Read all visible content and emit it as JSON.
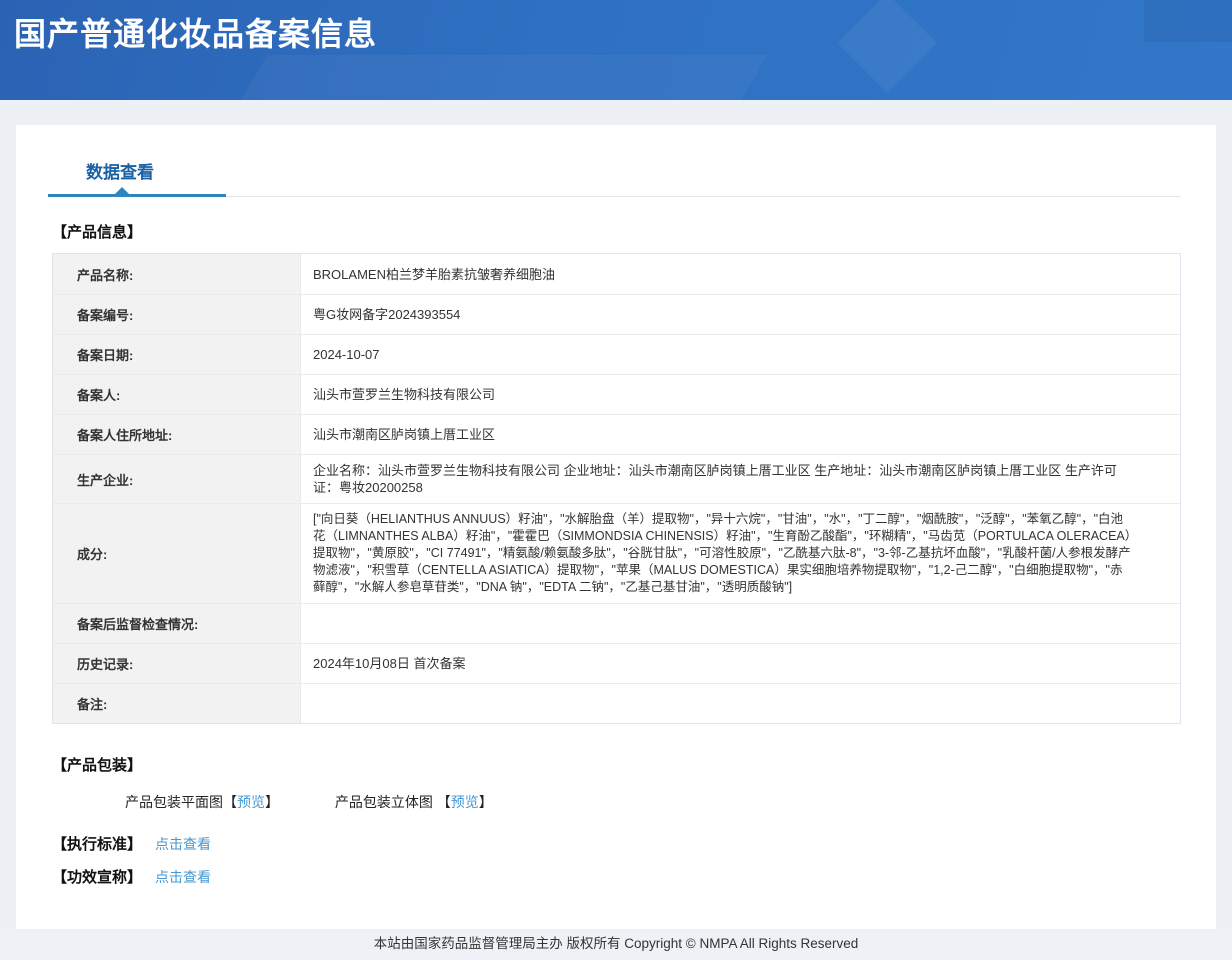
{
  "header": {
    "title": "国产普通化妆品备案信息"
  },
  "tabs": {
    "data_view": "数据查看"
  },
  "product_info": {
    "heading": "【产品信息】",
    "rows": [
      {
        "label": "产品名称:",
        "value": "BROLAMEN柏兰梦羊胎素抗皱奢养细胞油"
      },
      {
        "label": "备案编号:",
        "value": "粤G妆网备字2024393554"
      },
      {
        "label": "备案日期:",
        "value": "2024-10-07"
      },
      {
        "label": "备案人:",
        "value": "汕头市萱罗兰生物科技有限公司"
      },
      {
        "label": "备案人住所地址:",
        "value": "汕头市潮南区胪岗镇上厝工业区"
      },
      {
        "label": "生产企业:",
        "value": "企业名称：汕头市萱罗兰生物科技有限公司 企业地址：汕头市潮南区胪岗镇上厝工业区 生产地址：汕头市潮南区胪岗镇上厝工业区 生产许可证：粤妆20200258"
      },
      {
        "label": "成分:",
        "value": "[\"向日葵（HELIANTHUS ANNUUS）籽油\"，\"水解胎盘（羊）提取物\"，\"异十六烷\"，\"甘油\"，\"水\"，\"丁二醇\"，\"烟酰胺\"，\"泛醇\"，\"苯氧乙醇\"，\"白池花（LIMNANTHES ALBA）籽油\"，\"霍霍巴（SIMMONDSIA CHINENSIS）籽油\"，\"生育酚乙酸酯\"，\"环糊精\"，\"马齿苋（PORTULACA OLERACEA）提取物\"，\"黄原胶\"，\"CI 77491\"，\"精氨酸/赖氨酸多肽\"，\"谷胱甘肽\"，\"可溶性胶原\"，\"乙酰基六肽-8\"，\"3-邻-乙基抗坏血酸\"，\"乳酸杆菌/人参根发酵产物滤液\"，\"积雪草（CENTELLA ASIATICA）提取物\"，\"苹果（MALUS DOMESTICA）果实细胞培养物提取物\"，\"1,2-己二醇\"，\"白细胞提取物\"，\"赤藓醇\"，\"水解人参皂草苷类\"，\"DNA 钠\"，\"EDTA 二钠\"，\"乙基己基甘油\"，\"透明质酸钠\"]"
      },
      {
        "label": "备案后监督检查情况:",
        "value": ""
      },
      {
        "label": "历史记录:",
        "value": "2024年10月08日 首次备案"
      },
      {
        "label": "备注:",
        "value": ""
      }
    ]
  },
  "package": {
    "heading": "【产品包装】",
    "flat": {
      "prefix": "产品包装平面图【",
      "link": "预览",
      "suffix": "】"
    },
    "stereo": {
      "prefix": "产品包装立体图 【",
      "link": "预览",
      "suffix": "】"
    }
  },
  "exec_standard": {
    "heading": "【执行标准】",
    "link": "点击查看"
  },
  "efficacy": {
    "heading": "【功效宣称】",
    "link": "点击查看"
  },
  "footer": {
    "text": "本站由国家药品监督管理局主办 版权所有 Copyright © NMPA All Rights Reserved"
  },
  "colors": {
    "header_blue": "#2f70c2",
    "tab_text_blue": "#1b61a5",
    "accent_blue": "#2e86c1",
    "link_blue": "#4698d2",
    "label_bg": "#f2f2f2",
    "page_bg": "#edf1f6"
  }
}
